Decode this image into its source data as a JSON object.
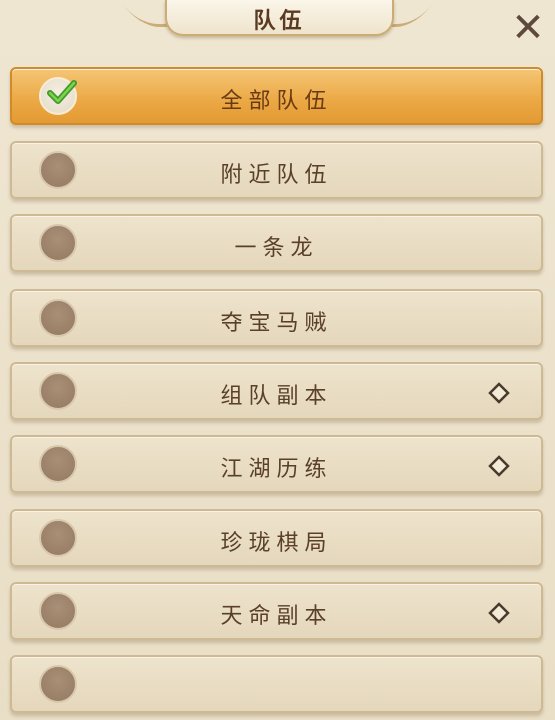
{
  "window": {
    "title": "队伍",
    "close_icon": "close-icon",
    "close_glyph": "✕"
  },
  "colors": {
    "selected_row": "#eba844",
    "row": "#e8dcc2",
    "text": "#5a3f2a"
  },
  "filters": [
    {
      "label": "全部队伍",
      "selected": true,
      "expandable": false
    },
    {
      "label": "附近队伍",
      "selected": false,
      "expandable": false
    },
    {
      "label": "一条龙",
      "selected": false,
      "expandable": false
    },
    {
      "label": "夺宝马贼",
      "selected": false,
      "expandable": false
    },
    {
      "label": "组队副本",
      "selected": false,
      "expandable": true
    },
    {
      "label": "江湖历练",
      "selected": false,
      "expandable": true
    },
    {
      "label": "珍珑棋局",
      "selected": false,
      "expandable": false
    },
    {
      "label": "天命副本",
      "selected": false,
      "expandable": true
    },
    {
      "label": "",
      "selected": false,
      "expandable": false
    }
  ]
}
